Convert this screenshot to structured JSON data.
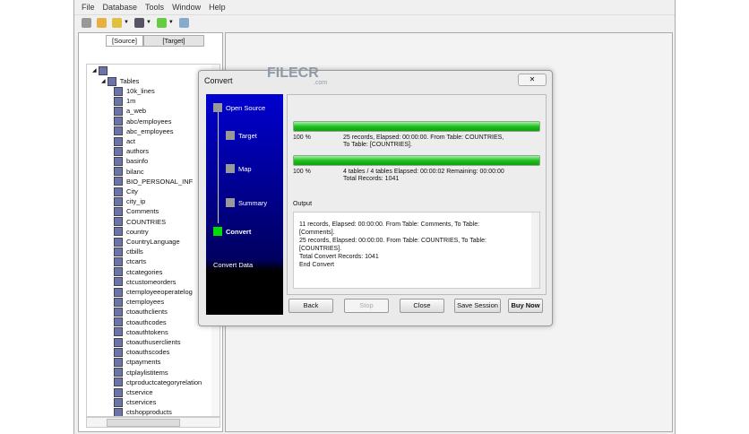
{
  "menu": [
    "File",
    "Database",
    "Tools",
    "Window",
    "Help"
  ],
  "tabs": {
    "source": "[Source]",
    "target": "[Target]"
  },
  "tree": {
    "root": "Tables",
    "items": [
      "10k_lines",
      "1m",
      "a_web",
      "abc/employees",
      "abc_employees",
      "act",
      "authors",
      "basinfo",
      "bilanc",
      "BIO_PERSONAL_INF",
      "City",
      "city_ip",
      "Comments",
      "COUNTRIES",
      "country",
      "CountryLanguage",
      "ctbills",
      "ctcarts",
      "ctcategories",
      "ctcustomeorders",
      "ctemployeeoperatelog",
      "ctemployees",
      "ctoauthclients",
      "ctoauthcodes",
      "ctoauthtokens",
      "ctoauthuserclients",
      "ctoauthscodes",
      "ctpayments",
      "ctplaylistitems",
      "ctproductcategoryrelation",
      "ctservice",
      "ctservices",
      "ctshopproducts"
    ]
  },
  "dialog": {
    "title": "Convert",
    "close": "✕",
    "steps": [
      "Open Source",
      "Target",
      "Map",
      "Summary",
      "Convert"
    ],
    "step_desc": "Convert Data",
    "progress1": {
      "value": 100,
      "pct": "100 %",
      "line1": "25 records,    Elapsed: 00:00:00.    From Table: COUNTRIES,",
      "line2": "To Table: [COUNTRIES]."
    },
    "progress2": {
      "value": 100,
      "pct": "100 %",
      "line1": "4 tables / 4 tables    Elapsed: 00:00:02    Remaining: 00:00:00",
      "line2": "Total Records: 1041"
    },
    "output_label": "Output",
    "output": [
      "11 records,    Elapsed: 00:00:00.    From Table: Comments,    To Table:",
      "[Comments].",
      "25 records,    Elapsed: 00:00:00.    From Table: COUNTRIES,    To Table:",
      "[COUNTRIES].",
      "Total Convert Records: 1041",
      "End Convert"
    ],
    "buttons": {
      "back": "Back",
      "stop": "Stop",
      "close": "Close",
      "save": "Save Session",
      "buy": "Buy Now"
    }
  },
  "watermark": {
    "brand": "FILECR",
    "sub": ".com"
  },
  "colors": {
    "progress": "#20c020",
    "active_step": "#00e000"
  }
}
